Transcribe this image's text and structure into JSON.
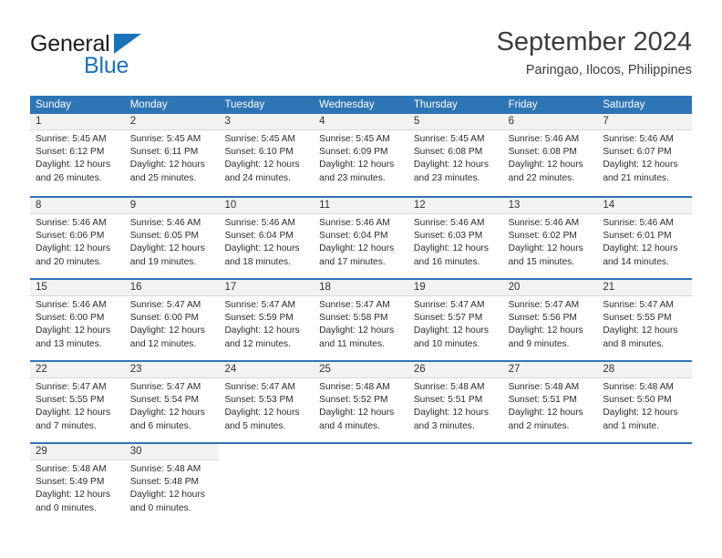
{
  "brand": {
    "name_top": "General",
    "name_bottom": "Blue",
    "accent_color": "#1a72b8"
  },
  "header": {
    "title": "September 2024",
    "subtitle": "Paringao, Ilocos, Philippines"
  },
  "theme": {
    "header_band": "#2e75b6",
    "day_band": "#f2f2f2",
    "text": "#2b2b2b"
  },
  "weekdays": [
    "Sunday",
    "Monday",
    "Tuesday",
    "Wednesday",
    "Thursday",
    "Friday",
    "Saturday"
  ],
  "weeks": [
    [
      {
        "day": "1",
        "lines": [
          "Sunrise: 5:45 AM",
          "Sunset: 6:12 PM",
          "Daylight: 12 hours",
          "and 26 minutes."
        ]
      },
      {
        "day": "2",
        "lines": [
          "Sunrise: 5:45 AM",
          "Sunset: 6:11 PM",
          "Daylight: 12 hours",
          "and 25 minutes."
        ]
      },
      {
        "day": "3",
        "lines": [
          "Sunrise: 5:45 AM",
          "Sunset: 6:10 PM",
          "Daylight: 12 hours",
          "and 24 minutes."
        ]
      },
      {
        "day": "4",
        "lines": [
          "Sunrise: 5:45 AM",
          "Sunset: 6:09 PM",
          "Daylight: 12 hours",
          "and 23 minutes."
        ]
      },
      {
        "day": "5",
        "lines": [
          "Sunrise: 5:45 AM",
          "Sunset: 6:08 PM",
          "Daylight: 12 hours",
          "and 23 minutes."
        ]
      },
      {
        "day": "6",
        "lines": [
          "Sunrise: 5:46 AM",
          "Sunset: 6:08 PM",
          "Daylight: 12 hours",
          "and 22 minutes."
        ]
      },
      {
        "day": "7",
        "lines": [
          "Sunrise: 5:46 AM",
          "Sunset: 6:07 PM",
          "Daylight: 12 hours",
          "and 21 minutes."
        ]
      }
    ],
    [
      {
        "day": "8",
        "lines": [
          "Sunrise: 5:46 AM",
          "Sunset: 6:06 PM",
          "Daylight: 12 hours",
          "and 20 minutes."
        ]
      },
      {
        "day": "9",
        "lines": [
          "Sunrise: 5:46 AM",
          "Sunset: 6:05 PM",
          "Daylight: 12 hours",
          "and 19 minutes."
        ]
      },
      {
        "day": "10",
        "lines": [
          "Sunrise: 5:46 AM",
          "Sunset: 6:04 PM",
          "Daylight: 12 hours",
          "and 18 minutes."
        ]
      },
      {
        "day": "11",
        "lines": [
          "Sunrise: 5:46 AM",
          "Sunset: 6:04 PM",
          "Daylight: 12 hours",
          "and 17 minutes."
        ]
      },
      {
        "day": "12",
        "lines": [
          "Sunrise: 5:46 AM",
          "Sunset: 6:03 PM",
          "Daylight: 12 hours",
          "and 16 minutes."
        ]
      },
      {
        "day": "13",
        "lines": [
          "Sunrise: 5:46 AM",
          "Sunset: 6:02 PM",
          "Daylight: 12 hours",
          "and 15 minutes."
        ]
      },
      {
        "day": "14",
        "lines": [
          "Sunrise: 5:46 AM",
          "Sunset: 6:01 PM",
          "Daylight: 12 hours",
          "and 14 minutes."
        ]
      }
    ],
    [
      {
        "day": "15",
        "lines": [
          "Sunrise: 5:46 AM",
          "Sunset: 6:00 PM",
          "Daylight: 12 hours",
          "and 13 minutes."
        ]
      },
      {
        "day": "16",
        "lines": [
          "Sunrise: 5:47 AM",
          "Sunset: 6:00 PM",
          "Daylight: 12 hours",
          "and 12 minutes."
        ]
      },
      {
        "day": "17",
        "lines": [
          "Sunrise: 5:47 AM",
          "Sunset: 5:59 PM",
          "Daylight: 12 hours",
          "and 12 minutes."
        ]
      },
      {
        "day": "18",
        "lines": [
          "Sunrise: 5:47 AM",
          "Sunset: 5:58 PM",
          "Daylight: 12 hours",
          "and 11 minutes."
        ]
      },
      {
        "day": "19",
        "lines": [
          "Sunrise: 5:47 AM",
          "Sunset: 5:57 PM",
          "Daylight: 12 hours",
          "and 10 minutes."
        ]
      },
      {
        "day": "20",
        "lines": [
          "Sunrise: 5:47 AM",
          "Sunset: 5:56 PM",
          "Daylight: 12 hours",
          "and 9 minutes."
        ]
      },
      {
        "day": "21",
        "lines": [
          "Sunrise: 5:47 AM",
          "Sunset: 5:55 PM",
          "Daylight: 12 hours",
          "and 8 minutes."
        ]
      }
    ],
    [
      {
        "day": "22",
        "lines": [
          "Sunrise: 5:47 AM",
          "Sunset: 5:55 PM",
          "Daylight: 12 hours",
          "and 7 minutes."
        ]
      },
      {
        "day": "23",
        "lines": [
          "Sunrise: 5:47 AM",
          "Sunset: 5:54 PM",
          "Daylight: 12 hours",
          "and 6 minutes."
        ]
      },
      {
        "day": "24",
        "lines": [
          "Sunrise: 5:47 AM",
          "Sunset: 5:53 PM",
          "Daylight: 12 hours",
          "and 5 minutes."
        ]
      },
      {
        "day": "25",
        "lines": [
          "Sunrise: 5:48 AM",
          "Sunset: 5:52 PM",
          "Daylight: 12 hours",
          "and 4 minutes."
        ]
      },
      {
        "day": "26",
        "lines": [
          "Sunrise: 5:48 AM",
          "Sunset: 5:51 PM",
          "Daylight: 12 hours",
          "and 3 minutes."
        ]
      },
      {
        "day": "27",
        "lines": [
          "Sunrise: 5:48 AM",
          "Sunset: 5:51 PM",
          "Daylight: 12 hours",
          "and 2 minutes."
        ]
      },
      {
        "day": "28",
        "lines": [
          "Sunrise: 5:48 AM",
          "Sunset: 5:50 PM",
          "Daylight: 12 hours",
          "and 1 minute."
        ]
      }
    ],
    [
      {
        "day": "29",
        "lines": [
          "Sunrise: 5:48 AM",
          "Sunset: 5:49 PM",
          "Daylight: 12 hours",
          "and 0 minutes."
        ]
      },
      {
        "day": "30",
        "lines": [
          "Sunrise: 5:48 AM",
          "Sunset: 5:48 PM",
          "Daylight: 12 hours",
          "and 0 minutes."
        ]
      },
      {
        "day": "",
        "lines": []
      },
      {
        "day": "",
        "lines": []
      },
      {
        "day": "",
        "lines": []
      },
      {
        "day": "",
        "lines": []
      },
      {
        "day": "",
        "lines": []
      }
    ]
  ]
}
